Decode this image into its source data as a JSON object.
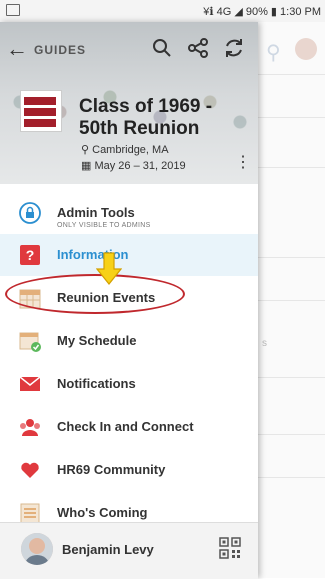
{
  "status_bar": {
    "right_text": "¥ℹ 4G ◢ 90% ▮ 1:30 PM"
  },
  "drawer": {
    "header": {
      "section_label": "GUIDES",
      "event_title": "Class of 1969 - 50th Reunion",
      "location": "Cambridge, MA",
      "dates": "May 26 – 31, 2019"
    },
    "menu": [
      {
        "label": "Admin Tools",
        "sublabel": "ONLY VISIBLE TO ADMINS",
        "icon": "lock-icon"
      },
      {
        "label": "Information",
        "icon": "question-icon",
        "active": true
      },
      {
        "label": "Reunion Events",
        "icon": "calendar-icon"
      },
      {
        "label": "My Schedule",
        "icon": "calendar-check-icon"
      },
      {
        "label": "Notifications",
        "icon": "envelope-icon"
      },
      {
        "label": "Check In and Connect",
        "icon": "people-icon"
      },
      {
        "label": "HR69 Community",
        "icon": "heart-icon"
      },
      {
        "label": "Who's Coming",
        "icon": "list-icon"
      }
    ],
    "user": {
      "name": "Benjamin Levy"
    }
  },
  "colors": {
    "accent": "#2b8fd0",
    "annotation_red": "#c0282d",
    "annotation_yellow": "#f7d117"
  },
  "background_text": "s"
}
